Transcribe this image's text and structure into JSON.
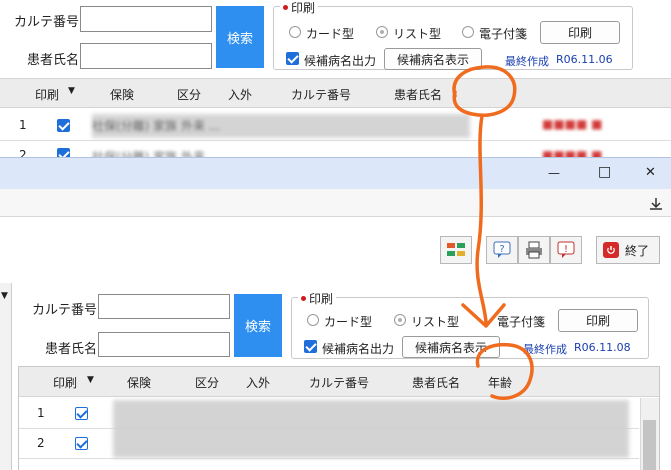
{
  "top": {
    "karte_label": "カルテ番号",
    "patient_label": "患者氏名",
    "search_label": "検索",
    "print_group_label": "印刷",
    "radio_card": "カード型",
    "radio_list": "リスト型",
    "radio_tag": "電子付箋",
    "print_button": "印刷",
    "candidate_output": "候補病名出力",
    "candidate_show": "候補病名表示",
    "last_created_label": "最終作成",
    "last_created_value": "R06.11.06",
    "columns": [
      "印刷",
      "保険",
      "区分",
      "入外",
      "カルテ番号",
      "患者氏名"
    ],
    "rows": [
      {
        "no": "1",
        "blur": "社保(分離)  家族  外来  ..."
      },
      {
        "no": "2",
        "blur": "社保(分離)  家族  外来  ..."
      }
    ]
  },
  "window": {
    "minimize": "—",
    "maximize": "□",
    "close": "✕",
    "end_label": "終了"
  },
  "bottom": {
    "karte_label": "カルテ番号",
    "patient_label": "患者氏名",
    "search_label": "検索",
    "print_group_label": "印刷",
    "radio_card": "カード型",
    "radio_list": "リスト型",
    "radio_tag": "電子付箋",
    "print_button": "印刷",
    "candidate_output": "候補病名出力",
    "candidate_show": "候補病名表示",
    "last_created_label": "最終作成",
    "last_created_value": "R06.11.08",
    "columns": [
      "印刷",
      "保険",
      "区分",
      "入外",
      "カルテ番号",
      "患者氏名",
      "年齢"
    ],
    "rows": [
      {
        "no": "1"
      },
      {
        "no": "2"
      }
    ]
  },
  "colors": {
    "accent_blue": "#2f8ff0",
    "checkbox_blue": "#1e6fd9",
    "annotation_orange": "#f06b1e",
    "titlebar_blue": "#dce8fa",
    "date_blue": "#1a3fb0"
  }
}
